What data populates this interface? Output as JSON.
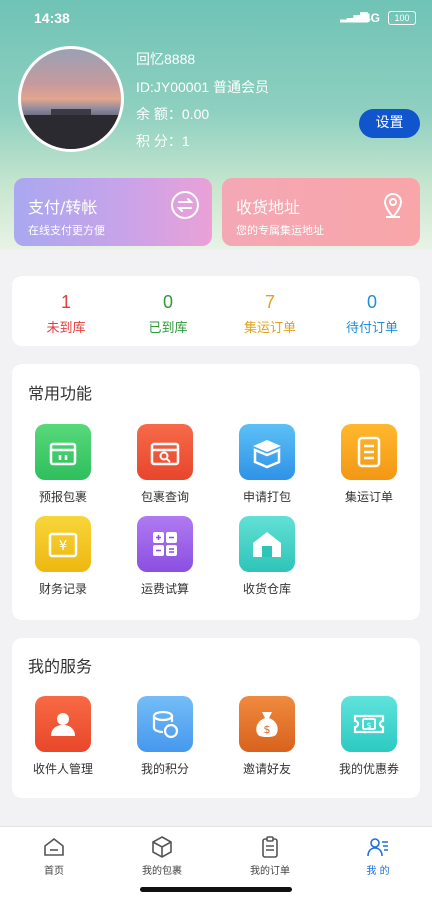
{
  "status_bar": {
    "time": "14:38",
    "network": "4G",
    "battery": "100"
  },
  "profile": {
    "username": "回忆8888",
    "member_id": "ID:JY00001 普通会员",
    "balance": "余 额：0.00",
    "points": "积 分：1",
    "settings_label": "设置"
  },
  "quick_cards": {
    "pay": {
      "title": "支付/转帐",
      "subtitle": "在线支付更方便"
    },
    "address": {
      "title": "收货地址",
      "subtitle": "您的专属集运地址"
    }
  },
  "order_stats": [
    {
      "count": "1",
      "label": "未到库",
      "color": "#e23c3c"
    },
    {
      "count": "0",
      "label": "已到库",
      "color": "#2f9a3b"
    },
    {
      "count": "7",
      "label": "集运订单",
      "color": "#e0a21f"
    },
    {
      "count": "0",
      "label": "待付订单",
      "color": "#1f8fd6"
    }
  ],
  "common_functions": {
    "title": "常用功能",
    "items": [
      {
        "label": "预报包裹",
        "icon": "forecast-package-icon",
        "color": "#3cc96a"
      },
      {
        "label": "包裹查询",
        "icon": "package-search-icon",
        "color": "#f0563c"
      },
      {
        "label": "申请打包",
        "icon": "pack-request-icon",
        "color": "#3fa6ee"
      },
      {
        "label": "集运订单",
        "icon": "consolidation-order-icon",
        "color": "#f5a623"
      },
      {
        "label": "财务记录",
        "icon": "finance-record-icon",
        "color": "#f2c81e"
      },
      {
        "label": "运费试算",
        "icon": "freight-calculator-icon",
        "color": "#9c5ce8"
      },
      {
        "label": "收货仓库",
        "icon": "warehouse-icon",
        "color": "#3fd1c4"
      }
    ]
  },
  "my_services": {
    "title": "我的服务",
    "items": [
      {
        "label": "收件人管理",
        "icon": "recipient-icon",
        "color": "#f25a3a"
      },
      {
        "label": "我的积分",
        "icon": "points-coins-icon",
        "color": "#5aaef5"
      },
      {
        "label": "邀请好友",
        "icon": "money-bag-icon",
        "color": "#e8732e"
      },
      {
        "label": "我的优惠券",
        "icon": "coupon-icon",
        "color": "#3fd6d0"
      }
    ]
  },
  "tab_bar": [
    {
      "label": "首页",
      "icon": "home-icon"
    },
    {
      "label": "我的包裹",
      "icon": "package-icon"
    },
    {
      "label": "我的订单",
      "icon": "order-clipboard-icon"
    },
    {
      "label": "我 的",
      "icon": "profile-icon",
      "active": true,
      "active_color": "#1f6fe0"
    }
  ]
}
